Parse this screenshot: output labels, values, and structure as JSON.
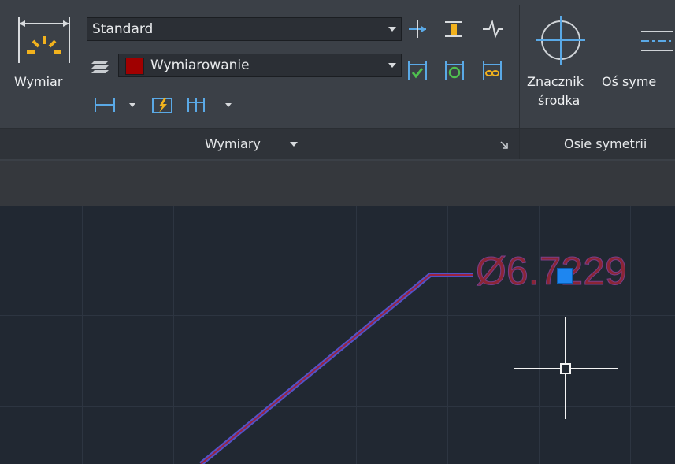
{
  "ribbon": {
    "dimension_label": "Wymiar",
    "dim_style": "Standard",
    "layer_name": "Wymiarowanie",
    "layer_color": "#a00000",
    "dimensions_panel_title": "Wymiary",
    "center_mark_label_1": "Znacznik",
    "center_mark_label_2": "środka",
    "centerline_label": "Oś syme",
    "centerlines_panel_title": "Osie symetrii"
  },
  "canvas": {
    "dimension_text": "Ø6.7229",
    "text_color": "#8b2535",
    "leader_color": "#7a3e8a",
    "grip_color": "#1e86f0"
  },
  "icons": [
    "linear-dimension-icon",
    "layer-icon",
    "dim-style-dropdown-icon",
    "continue-icon",
    "quick-dim-icon",
    "baseline-icon",
    "insert-space-icon",
    "break-icon",
    "jog-icon",
    "check-icon",
    "update-icon",
    "reassociate-icon",
    "center-mark-icon",
    "centerline-icon",
    "crosshair-cursor-icon"
  ]
}
